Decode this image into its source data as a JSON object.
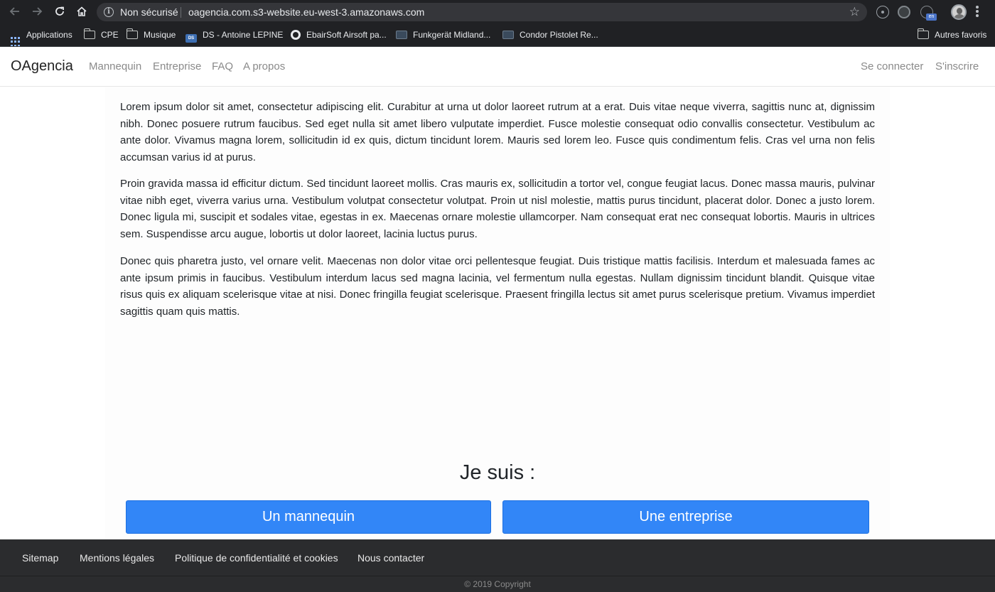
{
  "browser": {
    "security_label": "Non sécurisé",
    "url": "oagencia.com.s3-website.eu-west-3.amazonaws.com",
    "extension_badge": "en",
    "bookmarks": [
      {
        "label": "Applications",
        "icon": "apps-grid-icon"
      },
      {
        "label": "CPE",
        "icon": "folder-icon"
      },
      {
        "label": "Musique",
        "icon": "folder-icon"
      },
      {
        "label": "DS - Antoine LEPINE",
        "icon": "ds-favicon"
      },
      {
        "label": "EbairSoft Airsoft pa...",
        "icon": "globe-icon"
      },
      {
        "label": "Funkgerät Midland...",
        "icon": "site-favicon"
      },
      {
        "label": "Condor Pistolet Re...",
        "icon": "site-favicon"
      }
    ],
    "other_bookmarks": "Autres favoris"
  },
  "navbar": {
    "brand": "OAgencia",
    "links": [
      "Mannequin",
      "Entreprise",
      "FAQ",
      "A propos"
    ],
    "login": "Se connecter",
    "signup": "S'inscrire"
  },
  "main": {
    "paragraphs": [
      "Lorem ipsum dolor sit amet, consectetur adipiscing elit. Curabitur at urna ut dolor laoreet rutrum at a erat. Duis vitae neque viverra, sagittis nunc at, dignissim nibh. Donec posuere rutrum faucibus. Sed eget nulla sit amet libero vulputate imperdiet. Fusce molestie consequat odio convallis consectetur. Vestibulum ac ante dolor. Vivamus magna lorem, sollicitudin id ex quis, dictum tincidunt lorem. Mauris sed lorem leo. Fusce quis condimentum felis. Cras vel urna non felis accumsan varius id at purus.",
      "Proin gravida massa id efficitur dictum. Sed tincidunt laoreet mollis. Cras mauris ex, sollicitudin a tortor vel, congue feugiat lacus. Donec massa mauris, pulvinar vitae nibh eget, viverra varius urna. Vestibulum volutpat consectetur volutpat. Proin ut nisl molestie, mattis purus tincidunt, placerat dolor. Donec a justo lorem. Donec ligula mi, suscipit et sodales vitae, egestas in ex. Maecenas ornare molestie ullamcorper. Nam consequat erat nec consequat lobortis. Mauris in ultrices sem. Suspendisse arcu augue, lobortis ut dolor laoreet, lacinia luctus purus.",
      "Donec quis pharetra justo, vel ornare velit. Maecenas non dolor vitae orci pellentesque feugiat. Duis tristique mattis facilisis. Interdum et malesuada fames ac ante ipsum primis in faucibus. Vestibulum interdum lacus sed magna lacinia, vel fermentum nulla egestas. Nullam dignissim tincidunt blandit. Quisque vitae risus quis ex aliquam scelerisque vitae at nisi. Donec fringilla feugiat scelerisque. Praesent fringilla lectus sit amet purus scelerisque pretium. Vivamus imperdiet sagittis quam quis mattis."
    ],
    "cta_title": "Je suis :",
    "cta_model": "Un mannequin",
    "cta_company": "Une entreprise"
  },
  "footer": {
    "links": [
      "Sitemap",
      "Mentions légales",
      "Politique de confidentialité et cookies",
      "Nous contacter"
    ],
    "copyright": "© 2019 Copyright"
  },
  "colors": {
    "primary_button": "#3286f7",
    "browser_chrome": "#202124",
    "footer_bg": "#2b2c2e"
  }
}
